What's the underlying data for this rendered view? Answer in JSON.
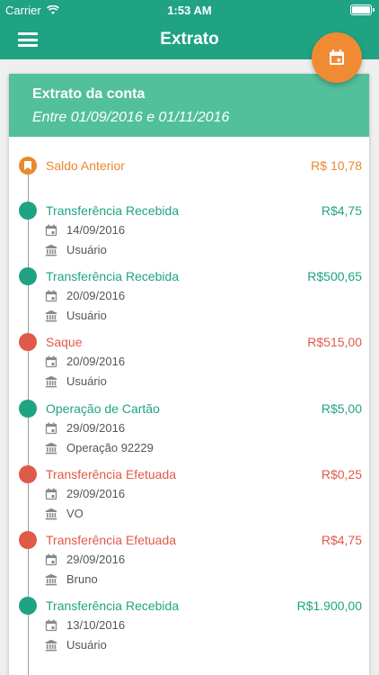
{
  "status_bar": {
    "carrier": "Carrier",
    "time": "1:53 AM"
  },
  "nav": {
    "title": "Extrato"
  },
  "statement": {
    "title": "Extrato da conta",
    "period": "Entre 01/09/2016 e 01/11/2016",
    "opening": {
      "label": "Saldo Anterior",
      "amount": "R$ 10,78"
    },
    "items": [
      {
        "title": "Transferência Recebida",
        "amount": "R$4,75",
        "date": "14/09/2016",
        "detail": "Usuário",
        "kind": "credit"
      },
      {
        "title": "Transferência Recebida",
        "amount": "R$500,65",
        "date": "20/09/2016",
        "detail": "Usuário",
        "kind": "credit"
      },
      {
        "title": "Saque",
        "amount": "R$515,00",
        "date": "20/09/2016",
        "detail": "Usuário",
        "kind": "debit"
      },
      {
        "title": "Operação de Cartão",
        "amount": "R$5,00",
        "date": "29/09/2016",
        "detail": "Operação 92229",
        "kind": "credit"
      },
      {
        "title": "Transferência Efetuada",
        "amount": "R$0,25",
        "date": "29/09/2016",
        "detail": "VO",
        "kind": "debit"
      },
      {
        "title": "Transferência Efetuada",
        "amount": "R$4,75",
        "date": "29/09/2016",
        "detail": "Bruno",
        "kind": "debit"
      },
      {
        "title": "Transferência Recebida",
        "amount": "R$1.900,00",
        "date": "13/10/2016",
        "detail": "Usuário",
        "kind": "credit"
      }
    ]
  },
  "colors": {
    "primary": "#1fa383",
    "header": "#52c09b",
    "accent": "#f08a33",
    "credit": "#1fa383",
    "debit": "#df5a49",
    "opening": "#e9892f"
  },
  "icons": {
    "menu": "hamburger-menu-icon",
    "fab": "calendar-icon",
    "date": "calendar-icon",
    "detail": "bank-icon",
    "opening": "bookmark-icon"
  }
}
